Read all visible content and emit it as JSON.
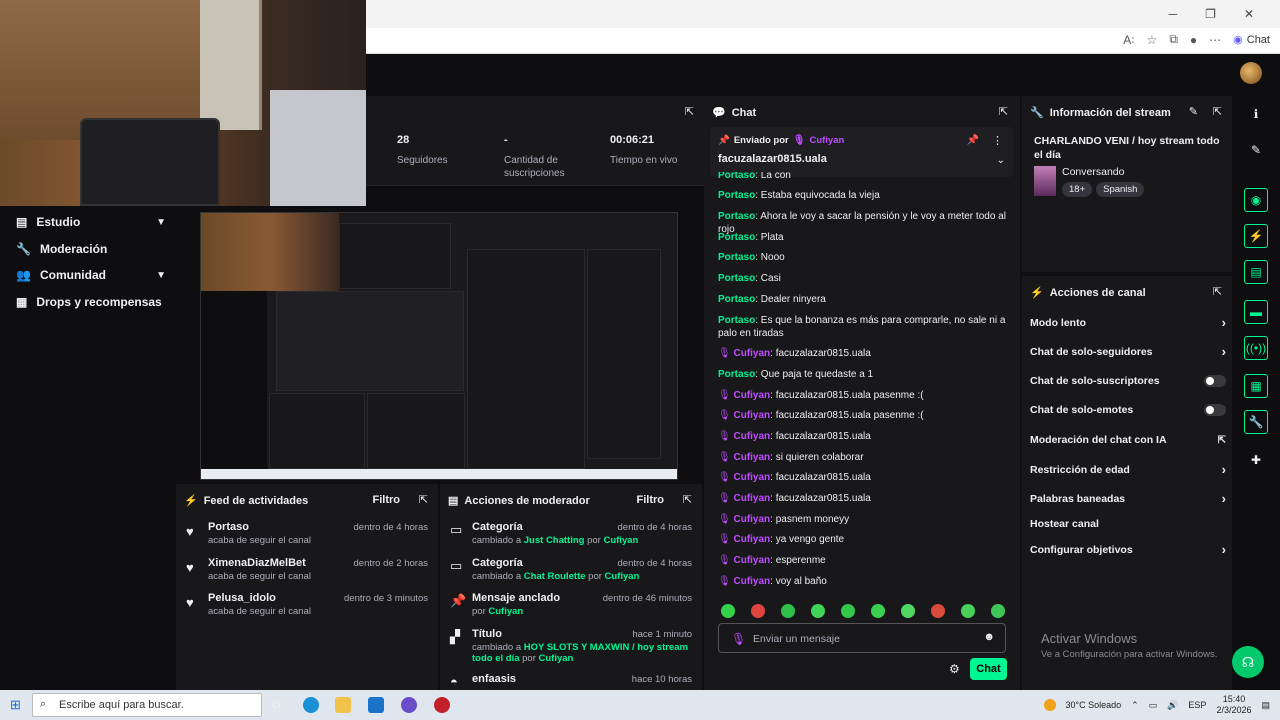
{
  "browser": {
    "chat_label": "Chat"
  },
  "stats": [
    {
      "value": "28",
      "label": "Seguidores"
    },
    {
      "value": "-",
      "label": "Cantidad de suscripciones"
    },
    {
      "value": "00:06:21",
      "label": "Tiempo en vivo"
    }
  ],
  "sidebar": {
    "items": [
      {
        "label": "Estudio",
        "icon": "studio-icon",
        "chevron": true
      },
      {
        "label": "Moderación",
        "icon": "wrench-icon",
        "chevron": false
      },
      {
        "label": "Comunidad",
        "icon": "community-icon",
        "chevron": true
      },
      {
        "label": "Drops y recompensas",
        "icon": "drops-icon",
        "chevron": false
      }
    ]
  },
  "feed": {
    "title": "Feed de actividades",
    "filter": "Filtro",
    "items": [
      {
        "name": "Portaso",
        "sub": "acaba de seguir el canal",
        "time": "dentro de 4 horas"
      },
      {
        "name": "XimenaDiazMelBet",
        "sub": "acaba de seguir el canal",
        "time": "dentro de 2 horas"
      },
      {
        "name": "Pelusa_idolo",
        "sub": "acaba de seguir el canal",
        "time": "dentro de 3 minutos"
      }
    ]
  },
  "modactions": {
    "title": "Acciones de moderador",
    "filter": "Filtro",
    "items": [
      {
        "name": "Categoría",
        "pre": "cambiado a ",
        "hl": "Just Chatting",
        "mid": " por ",
        "by": "Cufiyan",
        "time": "dentro de 4 horas"
      },
      {
        "name": "Categoría",
        "pre": "cambiado a ",
        "hl": "Chat Roulette",
        "mid": " por ",
        "by": "Cufiyan",
        "time": "dentro de 4 horas"
      },
      {
        "name": "Mensaje anclado",
        "pre": "por ",
        "hl": "Cufiyan",
        "mid": "",
        "by": "",
        "time": "dentro de 46 minutos"
      },
      {
        "name": "Título",
        "pre": "cambiado a ",
        "hl": "HOY SLOTS Y MAXWIN / hoy stream todo el día",
        "mid": " por ",
        "by": "Cufiyan",
        "time": "hace 1 minuto"
      },
      {
        "name": "enfaasis",
        "pre": "",
        "hl": "",
        "mid": "",
        "by": "",
        "time": "hace 10 horas"
      }
    ]
  },
  "chat": {
    "title": "Chat",
    "pinned_by_label": "Enviado por",
    "pinned_by": "Cufiyan",
    "pinned_text": "facuzalazar0815.uala",
    "messages": [
      {
        "user": "Portaso",
        "text": "La con",
        "type": "p"
      },
      {
        "user": "Portaso",
        "text": "Estaba equivocada la vieja",
        "type": "p"
      },
      {
        "user": "Portaso",
        "text": "Ahora le voy a sacar la pensión y le voy a meter todo al rojo",
        "type": "p"
      },
      {
        "user": "Portaso",
        "text": "Plata",
        "type": "p"
      },
      {
        "user": "Portaso",
        "text": "Nooo",
        "type": "p"
      },
      {
        "user": "Portaso",
        "text": "Casi",
        "type": "p"
      },
      {
        "user": "Portaso",
        "text": "Dealer ninyera",
        "type": "p"
      },
      {
        "user": "Portaso",
        "text": "Es que la bonanza es más para comprarle, no sale ni a palo en tiradas",
        "type": "p"
      },
      {
        "user": "Cufiyan",
        "text": "facuzalazar0815.uala",
        "type": "c"
      },
      {
        "user": "Portaso",
        "text": "Que paja te quedaste a 1",
        "type": "p"
      },
      {
        "user": "Cufiyan",
        "text": "facuzalazar0815.uala pasenme :(",
        "type": "c"
      },
      {
        "user": "Cufiyan",
        "text": "facuzalazar0815.uala pasenme :(",
        "type": "c"
      },
      {
        "user": "Cufiyan",
        "text": "facuzalazar0815.uala",
        "type": "c"
      },
      {
        "user": "Cufiyan",
        "text": "si quieren colaborar",
        "type": "c"
      },
      {
        "user": "Cufiyan",
        "text": "facuzalazar0815.uala",
        "type": "c"
      },
      {
        "user": "Cufiyan",
        "text": "facuzalazar0815.uala",
        "type": "c"
      },
      {
        "user": "Cufiyan",
        "text": "pasnem moneyy",
        "type": "c"
      },
      {
        "user": "Cufiyan",
        "text": "ya vengo gente",
        "type": "c"
      },
      {
        "user": "Cufiyan",
        "text": "esperenme",
        "type": "c"
      },
      {
        "user": "Cufiyan",
        "text": "voy al baño",
        "type": "c"
      }
    ],
    "input_placeholder": "Enviar un mensaje",
    "send_label": "Chat"
  },
  "streaminfo": {
    "title": "Información del stream",
    "stream_title": "CHARLANDO VENI / hoy stream todo el día",
    "category": "Conversando",
    "tags": [
      "18+",
      "Spanish"
    ]
  },
  "channelactions": {
    "title": "Acciones de canal",
    "items": [
      {
        "label": "Modo lento",
        "control": "chevron"
      },
      {
        "label": "Chat de solo-seguidores",
        "control": "chevron"
      },
      {
        "label": "Chat de solo-suscriptores",
        "control": "toggle"
      },
      {
        "label": "Chat de solo-emotes",
        "control": "toggle"
      },
      {
        "label": "Moderación del chat con IA",
        "control": "external"
      },
      {
        "label": "Restricción de edad",
        "control": "chevron"
      },
      {
        "label": "Palabras baneadas",
        "control": "chevron"
      },
      {
        "label": "Hostear canal",
        "control": "none"
      },
      {
        "label": "Configurar objetivos",
        "control": "chevron"
      }
    ]
  },
  "watermark": {
    "title": "Activar Windows",
    "sub": "Ve a Configuración para activar Windows."
  },
  "taskbar": {
    "search_placeholder": "Escribe aquí para buscar.",
    "weather": "30°C  Soleado",
    "lang": "ESP",
    "time": "15:40",
    "date": "2/3/2026"
  }
}
